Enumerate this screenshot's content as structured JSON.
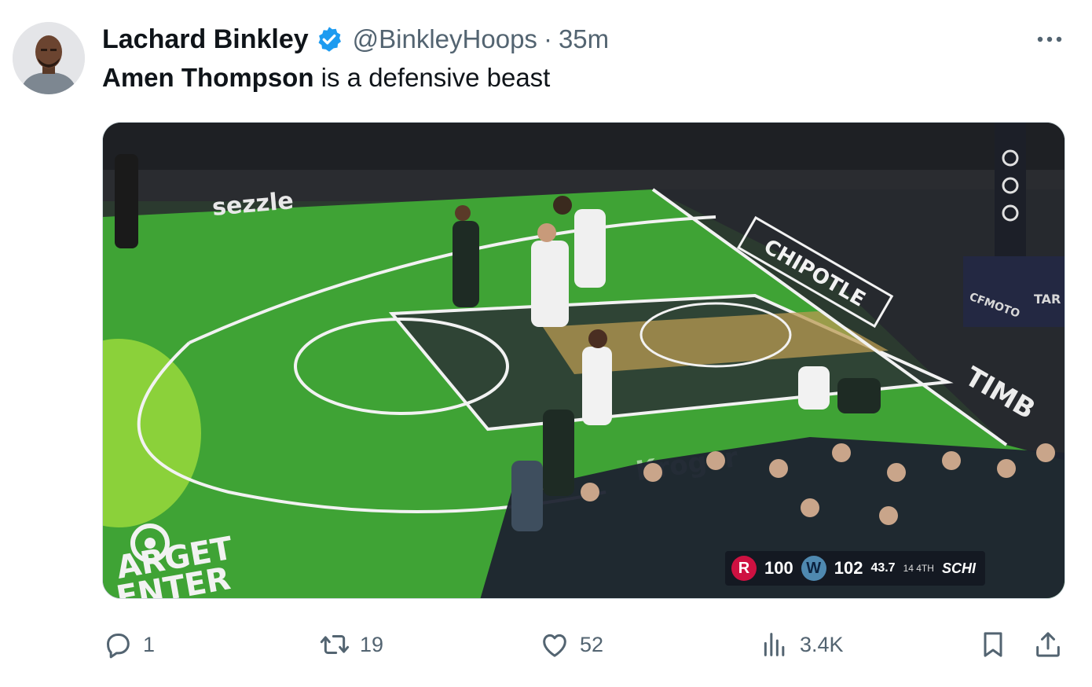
{
  "author": {
    "display_name": "Lachard Binkley",
    "handle": "@BinkleyHoops",
    "separator": "·",
    "time": "35m",
    "verified_color": "#1d9bf0"
  },
  "tweet": {
    "mention": "Amen Thompson",
    "text_rest": " is a defensive beast"
  },
  "media": {
    "scoreboard": {
      "home_score": "100",
      "away_score": "102",
      "clock": "43.7",
      "period": "14 4TH",
      "network": "SCHI"
    },
    "court_text": {
      "sponsor_sezzle": "sezzle",
      "sponsor_chipotle": "CHIPOTLE",
      "sponsor_kroger": "Kroger",
      "target_line1": "ARGET",
      "target_line2": "ENTER",
      "target_side": "TAR CEN",
      "cfmoto": "CFMOTO",
      "timberwolves": "TIMB"
    },
    "colors": {
      "court_green": "#3fa335",
      "paint_dark": "#2d3a35"
    }
  },
  "actions": {
    "reply_count": "1",
    "retweet_count": "19",
    "like_count": "52",
    "views_count": "3.4K"
  },
  "icons": [
    "verified-badge-icon",
    "more-icon",
    "reply-icon",
    "retweet-icon",
    "like-icon",
    "views-icon",
    "bookmark-icon",
    "share-icon"
  ]
}
